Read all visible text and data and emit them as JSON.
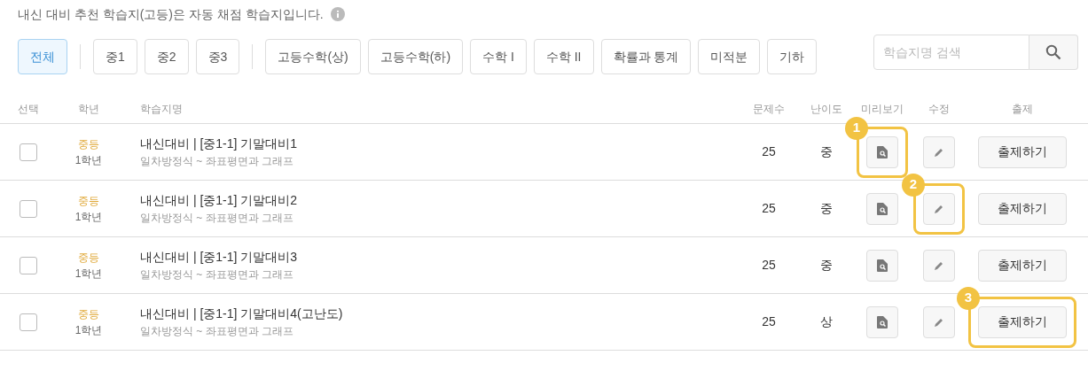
{
  "notice": "내신 대비 추천 학습지(고등)은 자동 채점 학습지입니다.",
  "filter_groups": [
    [
      {
        "label": "전체",
        "selected": true
      }
    ],
    [
      {
        "label": "중1",
        "selected": false
      },
      {
        "label": "중2",
        "selected": false
      },
      {
        "label": "중3",
        "selected": false
      }
    ],
    [
      {
        "label": "고등수학(상)",
        "selected": false
      },
      {
        "label": "고등수학(하)",
        "selected": false
      },
      {
        "label": "수학 I",
        "selected": false
      },
      {
        "label": "수학 II",
        "selected": false
      },
      {
        "label": "확률과 통계",
        "selected": false
      },
      {
        "label": "미적분",
        "selected": false
      },
      {
        "label": "기하",
        "selected": false
      }
    ]
  ],
  "search": {
    "placeholder": "학습지명 검색"
  },
  "table": {
    "columns": [
      "선택",
      "학년",
      "학습지명",
      "문제수",
      "난이도",
      "미리보기",
      "수정",
      "출제"
    ],
    "rows": [
      {
        "checked": false,
        "level_name": "중등",
        "grade": "1학년",
        "title": "내신대비 | [중1-1] 기말대비1",
        "range": "일차방정식 ~ 좌표평면과 그래프",
        "count": "25",
        "difficulty": "중",
        "submit": "출제하기",
        "preview_callout": "1"
      },
      {
        "checked": false,
        "level_name": "중등",
        "grade": "1학년",
        "title": "내신대비 | [중1-1] 기말대비2",
        "range": "일차방정식 ~ 좌표평면과 그래프",
        "count": "25",
        "difficulty": "중",
        "submit": "출제하기",
        "edit_callout": "2"
      },
      {
        "checked": false,
        "level_name": "중등",
        "grade": "1학년",
        "title": "내신대비 | [중1-1] 기말대비3",
        "range": "일차방정식 ~ 좌표평면과 그래프",
        "count": "25",
        "difficulty": "중",
        "submit": "출제하기"
      },
      {
        "checked": false,
        "level_name": "중등",
        "grade": "1학년",
        "title": "내신대비 | [중1-1] 기말대비4(고난도)",
        "range": "일차방정식 ~ 좌표평면과 그래프",
        "count": "25",
        "difficulty": "상",
        "submit": "출제하기",
        "submit_callout": "3"
      }
    ]
  }
}
